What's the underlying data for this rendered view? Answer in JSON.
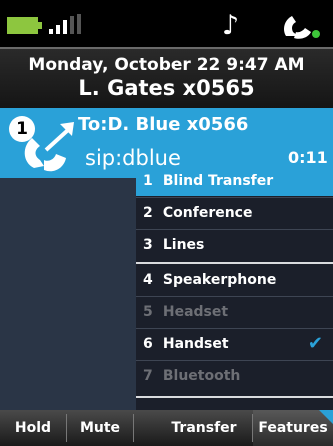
{
  "status": {
    "battery_icon": "battery-icon",
    "signal_icon": "signal-bars-icon",
    "music_icon": "music-note-icon",
    "presence_icon": "presence-phone-icon",
    "battery_color": "#8dc63f"
  },
  "header": {
    "date_time": "Monday, October 22 9:47 AM",
    "user": "L. Gates x0565"
  },
  "call": {
    "line_number": "1",
    "to": "To:D. Blue x0566",
    "sip": "sip:dblue",
    "timer": "0:11",
    "accent": "#2aa1d8"
  },
  "menu": {
    "items": [
      {
        "num": "1",
        "label": "Blind Transfer"
      },
      {
        "num": "2",
        "label": "Conference"
      },
      {
        "num": "3",
        "label": "Lines"
      },
      {
        "num": "4",
        "label": "Speakerphone"
      },
      {
        "num": "5",
        "label": "Headset"
      },
      {
        "num": "6",
        "label": "Handset"
      },
      {
        "num": "7",
        "label": "Bluetooth"
      }
    ],
    "check": "✔"
  },
  "softkeys": {
    "hold": "Hold",
    "mute": "Mute",
    "transfer": "Transfer",
    "features": "Features"
  }
}
